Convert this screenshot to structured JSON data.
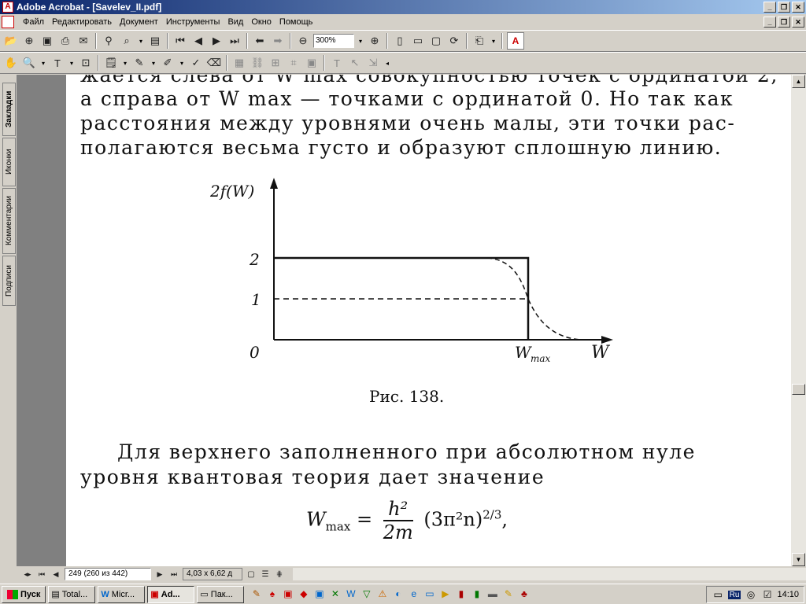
{
  "window": {
    "title": "Adobe Acrobat - [Savelev_II.pdf]",
    "minimize": "_",
    "restore": "❐",
    "close": "✕"
  },
  "menu": {
    "items": [
      "Файл",
      "Редактировать",
      "Документ",
      "Инструменты",
      "Вид",
      "Окно",
      "Помощь"
    ]
  },
  "toolbar": {
    "zoom_value": "300%",
    "acrobat_logo": "A"
  },
  "nav_tabs": [
    "Закладки",
    "Иконки",
    "Комментарии",
    "Подписи"
  ],
  "document": {
    "lines_top": [
      "жается слева от W max совокупностью точек с ординатой 2,",
      "а справа от W max — точками с ординатой 0. Но так как",
      "расстояния между уровнями очень малы, эти точки рас-",
      "полагаются весьма густо и образуют сплошную линию."
    ],
    "figure": {
      "y_axis_label": "2f(W)",
      "x_axis_label": "W",
      "tick_2": "2",
      "tick_1": "1",
      "tick_0": "0",
      "wmax_label": "W",
      "wmax_sub": "max",
      "caption": "Рис. 138."
    },
    "lines_bottom": [
      "Для верхнего заполненного при абсолютном нуле",
      "уровня квантовая теория дает значение"
    ],
    "formula": {
      "lhs": "W",
      "lhs_sub": "max",
      "equals": "=",
      "numerator": "h²",
      "denominator": "2m",
      "rhs": "(3π²n)",
      "rhs_exp": "2/3",
      "tail": ","
    }
  },
  "statusbar": {
    "page_field": "249 (260 из 442)",
    "page_size": "4,03 x 6,62 д"
  },
  "taskbar": {
    "start": "Пуск",
    "tasks": [
      "Total...",
      "Micr...",
      "Ad...",
      "Пак..."
    ],
    "lang": "Ru",
    "clock": "14:10"
  }
}
